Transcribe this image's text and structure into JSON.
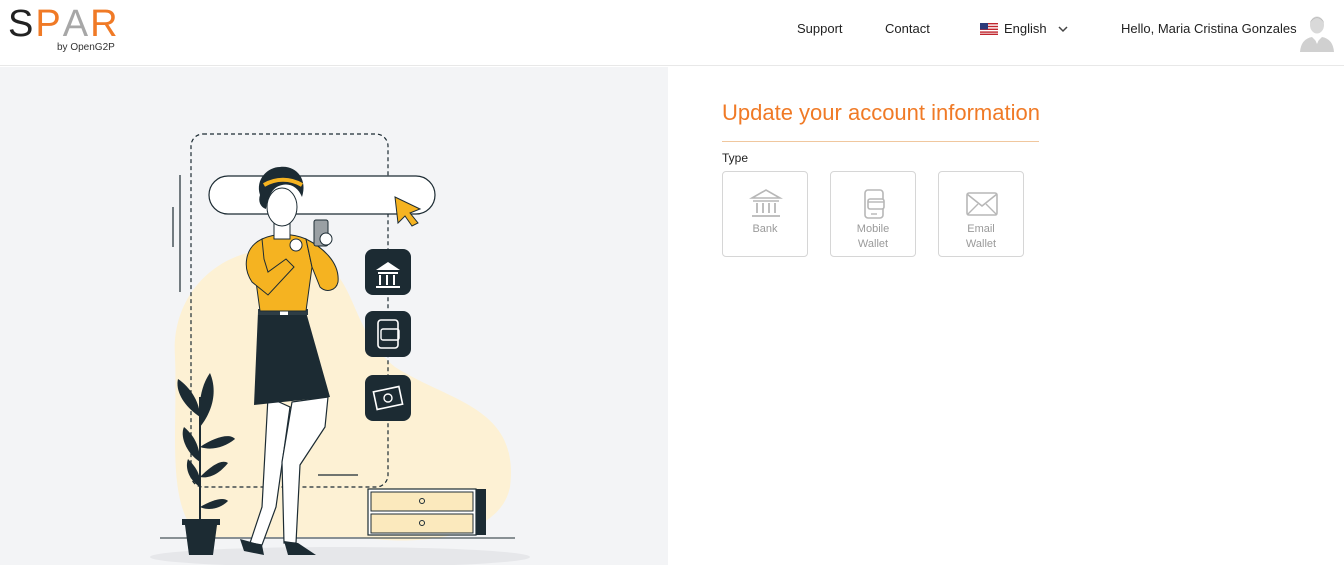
{
  "brand": {
    "letters": [
      {
        "char": "S",
        "color": "#222222"
      },
      {
        "char": "P",
        "color": "#f07a26"
      },
      {
        "char": "A",
        "color": "#a7a7a7"
      },
      {
        "char": "R",
        "color": "#f07a26"
      }
    ],
    "subtitle": "by OpenG2P"
  },
  "header": {
    "support_label": "Support",
    "contact_label": "Contact",
    "language_label": "English",
    "greeting": "Hello, Maria Cristina Gonzales"
  },
  "form": {
    "title": "Update your account information",
    "type_label": "Type",
    "types": [
      {
        "label": "Bank",
        "icon": "bank-icon"
      },
      {
        "label": "Mobile Wallet",
        "icon": "mobile-wallet-icon"
      },
      {
        "label": "Email Wallet",
        "icon": "email-icon"
      }
    ]
  },
  "colors": {
    "accent": "#f07a26",
    "panel_bg": "#f3f4f6",
    "illustration_yellow": "#f5b321",
    "illustration_dark": "#1c2b33"
  }
}
